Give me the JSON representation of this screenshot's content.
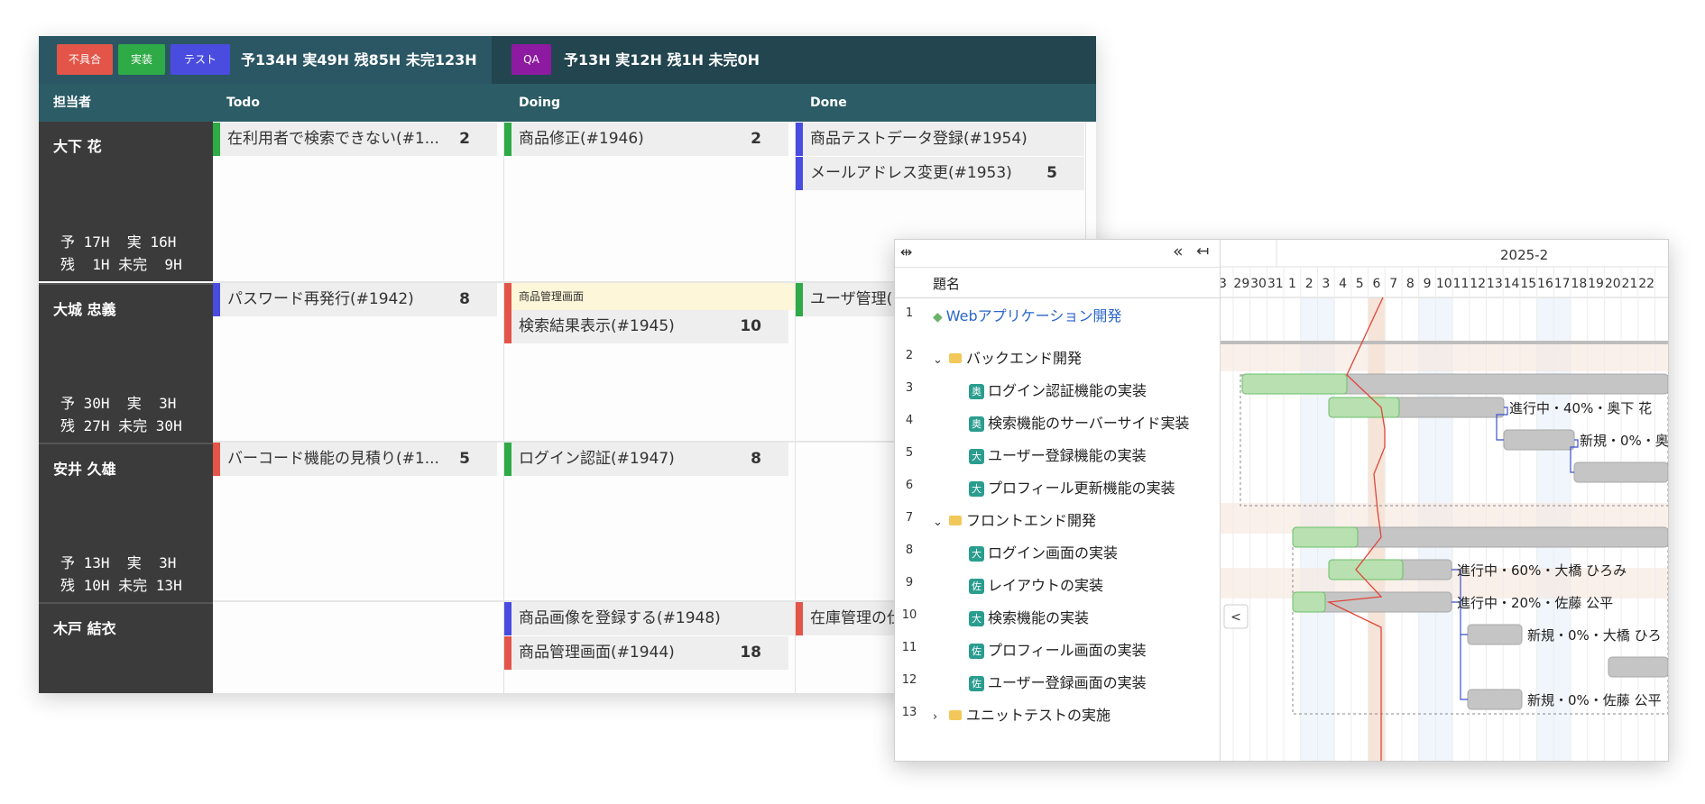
{
  "kanban": {
    "filters": [
      {
        "label": "不具合",
        "color": "#e25548"
      },
      {
        "label": "実装",
        "color": "#2eaa46"
      },
      {
        "label": "テスト",
        "color": "#4a4ce0"
      },
      {
        "label": "QA",
        "color": "#8d1aa0"
      }
    ],
    "summary_main": "予134H 実49H 残85H 未完123H",
    "summary_qa": "予13H 実12H 残1H 未完0H",
    "columns": {
      "assignee": "担当者",
      "todo": "Todo",
      "doing": "Doing",
      "done": "Done"
    },
    "people": [
      {
        "name": "大下 花",
        "stat_line1": "予 17H  実 16H",
        "stat_line2": "残  1H 未完  9H"
      },
      {
        "name": "大城 忠義",
        "stat_line1": "予 30H  実  3H",
        "stat_line2": "残 27H 未完 30H"
      },
      {
        "name": "安井 久雄",
        "stat_line1": "予 13H  実  3H",
        "stat_line2": "残 10H 未完 13H"
      },
      {
        "name": "木戸 結衣",
        "stat_line1": "",
        "stat_line2": ""
      }
    ],
    "cards": {
      "p1_todo_1": {
        "title": "在利用者で検索できない(#1...",
        "points": "2"
      },
      "p1_doing_1": {
        "title": "商品修正(#1946)",
        "points": "2"
      },
      "p1_done_1": {
        "title": "商品テストデータ登録(#1954)",
        "points": ""
      },
      "p1_done_2": {
        "title": "メールアドレス変更(#1953)",
        "points": "5"
      },
      "p2_todo_1": {
        "title": "パスワード再発行(#1942)",
        "points": "8"
      },
      "p2_doing_note": {
        "title": "商品管理画面"
      },
      "p2_doing_1": {
        "title": "検索結果表示(#1945)",
        "points": "10"
      },
      "p2_done_1": {
        "title": "ユーザ管理(",
        "points": ""
      },
      "p3_todo_1": {
        "title": "バーコード機能の見積り(#1...",
        "points": "5"
      },
      "p3_doing_1": {
        "title": "ログイン認証(#1947)",
        "points": "8"
      },
      "p4_doing_1": {
        "title": "商品画像を登録する(#1948)",
        "points": ""
      },
      "p4_doing_2": {
        "title": "商品管理画面(#1944)",
        "points": "18"
      },
      "p4_done_1": {
        "title": "在庫管理の仕",
        "points": ""
      }
    }
  },
  "gantt": {
    "toolbar": {
      "collapse_icon": "⇹",
      "collapse_all": "«",
      "arrow": "↤"
    },
    "header": {
      "col_title": "題名",
      "month": "2025-2",
      "days": [
        "29",
        "30",
        "31",
        "1",
        "2",
        "3",
        "4",
        "5",
        "6",
        "7",
        "8",
        "9",
        "10",
        "11",
        "12",
        "13",
        "14",
        "15",
        "16",
        "17",
        "18",
        "19",
        "20",
        "21",
        "22"
      ],
      "first_day_partial": "3"
    },
    "rows": [
      {
        "num": "1",
        "title": "Webアプリケーション開発",
        "kind": "project"
      },
      {
        "num": "2",
        "title": "バックエンド開発",
        "kind": "group",
        "chev": "⌄"
      },
      {
        "num": "3",
        "title": "ログイン認証機能の実装",
        "kind": "task",
        "badge": "奥"
      },
      {
        "num": "4",
        "title": "検索機能のサーバーサイド実装",
        "kind": "task",
        "badge": "奥"
      },
      {
        "num": "5",
        "title": "ユーザー登録機能の実装",
        "kind": "task",
        "badge": "大"
      },
      {
        "num": "6",
        "title": "プロフィール更新機能の実装",
        "kind": "task",
        "badge": "大"
      },
      {
        "num": "7",
        "title": "フロントエンド開発",
        "kind": "group",
        "chev": "⌄"
      },
      {
        "num": "8",
        "title": "ログイン画面の実装",
        "kind": "task",
        "badge": "大"
      },
      {
        "num": "9",
        "title": "レイアウトの実装",
        "kind": "task",
        "badge": "佐"
      },
      {
        "num": "10",
        "title": "検索機能の実装",
        "kind": "task",
        "badge": "大"
      },
      {
        "num": "11",
        "title": "プロフィール画面の実装",
        "kind": "task",
        "badge": "佐"
      },
      {
        "num": "12",
        "title": "ユーザー登録画面の実装",
        "kind": "task",
        "badge": "佐"
      },
      {
        "num": "13",
        "title": "ユニットテストの実施",
        "kind": "group",
        "chev": "›"
      }
    ],
    "bar_labels": {
      "r3": "進行中・40%・奥下 花",
      "r4": "新規・0%・奥",
      "r8": "進行中・60%・大橋 ひろみ",
      "r9": "進行中・20%・佐藤 公平",
      "r10": "新規・0%・大橋 ひろ",
      "r12": "新規・0%・佐藤 公平"
    },
    "scroll_left_icon": "<"
  }
}
